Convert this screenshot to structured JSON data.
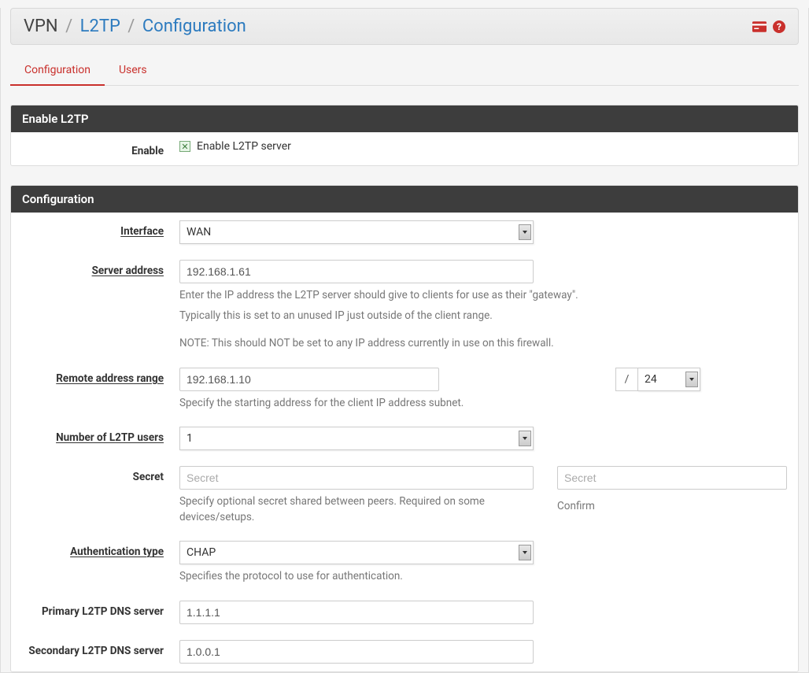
{
  "breadcrumb": {
    "root": "VPN",
    "mid": "L2TP",
    "current": "Configuration"
  },
  "tabs": {
    "configuration": "Configuration",
    "users": "Users"
  },
  "panel1": {
    "title": "Enable L2TP",
    "enable": {
      "label": "Enable",
      "text": "Enable L2TP server"
    }
  },
  "panel2": {
    "title": "Configuration",
    "interface": {
      "label": "Interface",
      "value": "WAN"
    },
    "server_address": {
      "label": "Server address",
      "value": "192.168.1.61",
      "help1": "Enter the IP address the L2TP server should give to clients for use as their \"gateway\".",
      "help2": "Typically this is set to an unused IP just outside of the client range.",
      "help3": "NOTE: This should NOT be set to any IP address currently in use on this firewall."
    },
    "remote_range": {
      "label": "Remote address range",
      "value": "192.168.1.10",
      "help": "Specify the starting address for the client IP address subnet.",
      "slash": "/",
      "subnet": "24"
    },
    "num_users": {
      "label": "Number of L2TP users",
      "value": "1"
    },
    "secret": {
      "label": "Secret",
      "placeholder": "Secret",
      "help": "Specify optional secret shared between peers. Required on some devices/setups.",
      "confirm_placeholder": "Secret",
      "confirm_label": "Confirm"
    },
    "auth_type": {
      "label": "Authentication type",
      "value": "CHAP",
      "help": "Specifies the protocol to use for authentication."
    },
    "dns1": {
      "label": "Primary L2TP DNS server",
      "value": "1.1.1.1"
    },
    "dns2": {
      "label": "Secondary L2TP DNS server",
      "value": "1.0.0.1"
    }
  }
}
